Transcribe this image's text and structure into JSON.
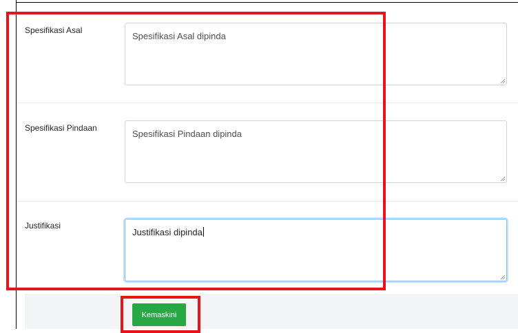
{
  "form": {
    "fields": [
      {
        "label": "Spesifikasi Asal",
        "value": "Spesifikasi Asal dipinda"
      },
      {
        "label": "Spesifikasi Pindaan",
        "value": "Spesifikasi Pindaan dipinda"
      },
      {
        "label": "Justifikasi",
        "value": "Justifikasi dipinda"
      }
    ],
    "submit_label": "Kemaskini"
  },
  "colors": {
    "highlight": "#e8121a",
    "submit_button": "#28a745",
    "focus_border": "#80bdff"
  },
  "icons": [
    "resize-grip-icon"
  ]
}
